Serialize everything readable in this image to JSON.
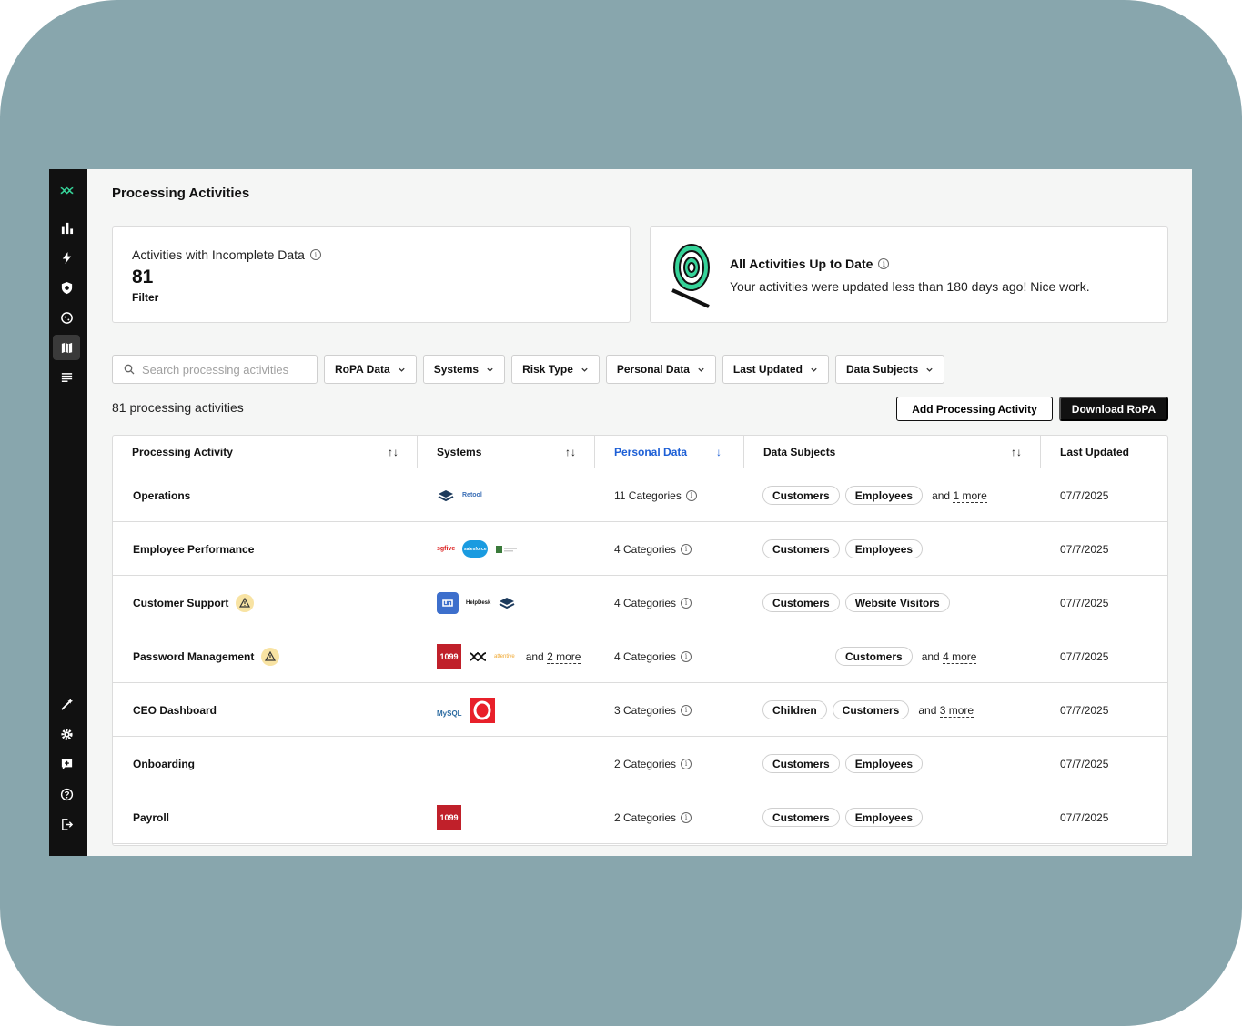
{
  "page": {
    "title": "Processing Activities"
  },
  "sidebar": {
    "icons": [
      "logo-icon",
      "chart-icon",
      "bolt-icon",
      "shield-icon",
      "cookie-icon",
      "map-icon",
      "document-icon",
      "magic-wand-icon",
      "gear-icon",
      "chat-plus-icon",
      "help-icon",
      "logout-icon"
    ]
  },
  "cards": {
    "incomplete": {
      "label": "Activities with Incomplete Data",
      "value": "81",
      "link": "Filter"
    },
    "uptodate": {
      "title": "All Activities Up to Date",
      "subtitle": "Your activities were updated less than 180 days ago! Nice work."
    }
  },
  "search": {
    "placeholder": "Search processing activities"
  },
  "filters": [
    "RoPA Data",
    "Systems",
    "Risk Type",
    "Personal Data",
    "Last Updated",
    "Data Subjects"
  ],
  "summary": {
    "count_text": "81 processing activities"
  },
  "actions": {
    "add_label": "Add Processing Activity",
    "download_label": "Download RoPA"
  },
  "table": {
    "columns": [
      "Processing Activity",
      "Systems",
      "Personal Data",
      "Data Subjects",
      "Last Updated"
    ],
    "rows": [
      {
        "name": "Operations",
        "warning": false,
        "systems": [
          "stack",
          "retool"
        ],
        "systems_more": "",
        "personal_data": "11 Categories",
        "subjects": [
          "Customers",
          "Employees"
        ],
        "subjects_more": "1 more",
        "updated": "07/7/2025"
      },
      {
        "name": "Employee Performance",
        "warning": false,
        "systems": [
          "sgfive",
          "salesforce",
          "world"
        ],
        "systems_more": "",
        "personal_data": "4 Categories",
        "subjects": [
          "Customers",
          "Employees"
        ],
        "subjects_more": "",
        "updated": "07/7/2025"
      },
      {
        "name": "Customer Support",
        "warning": true,
        "systems": [
          "helpscout",
          "helpdesk",
          "stack"
        ],
        "systems_more": "",
        "personal_data": "4 Categories",
        "subjects": [
          "Customers",
          "Website Visitors"
        ],
        "subjects_more": "",
        "updated": "07/7/2025"
      },
      {
        "name": "Password Management",
        "warning": true,
        "systems": [
          "1099",
          "transcend",
          "attentive"
        ],
        "systems_more": "2 more",
        "personal_data": "4 Categories",
        "subjects": [
          "Customers"
        ],
        "subjects_more": "4 more",
        "updated": "07/7/2025"
      },
      {
        "name": "CEO Dashboard",
        "warning": false,
        "systems": [
          "mysql",
          "opera"
        ],
        "systems_more": "",
        "personal_data": "3 Categories",
        "subjects": [
          "Children",
          "Customers"
        ],
        "subjects_more": "3 more",
        "updated": "07/7/2025"
      },
      {
        "name": "Onboarding",
        "warning": false,
        "systems": [],
        "systems_more": "",
        "personal_data": "2 Categories",
        "subjects": [
          "Customers",
          "Employees"
        ],
        "subjects_more": "",
        "updated": "07/7/2025"
      },
      {
        "name": "Payroll",
        "warning": false,
        "systems": [
          "1099"
        ],
        "systems_more": "",
        "personal_data": "2 Categories",
        "subjects": [
          "Customers",
          "Employees"
        ],
        "subjects_more": "",
        "updated": "07/7/2025"
      }
    ]
  },
  "logo_text": {
    "retool": "Retool",
    "sgfive": "sgfive",
    "salesforce": "salesforce",
    "helpdesk": "HelpDesk",
    "attentive": "attentive",
    "1099": "1099",
    "mysql": "MySQL"
  },
  "more_prefix": "and",
  "colors": {
    "accent": "#1d5fd6",
    "sidebar": "#111111",
    "brand": "#36d399",
    "warning": "#f8e3a3",
    "frame": "#88a6ad"
  }
}
